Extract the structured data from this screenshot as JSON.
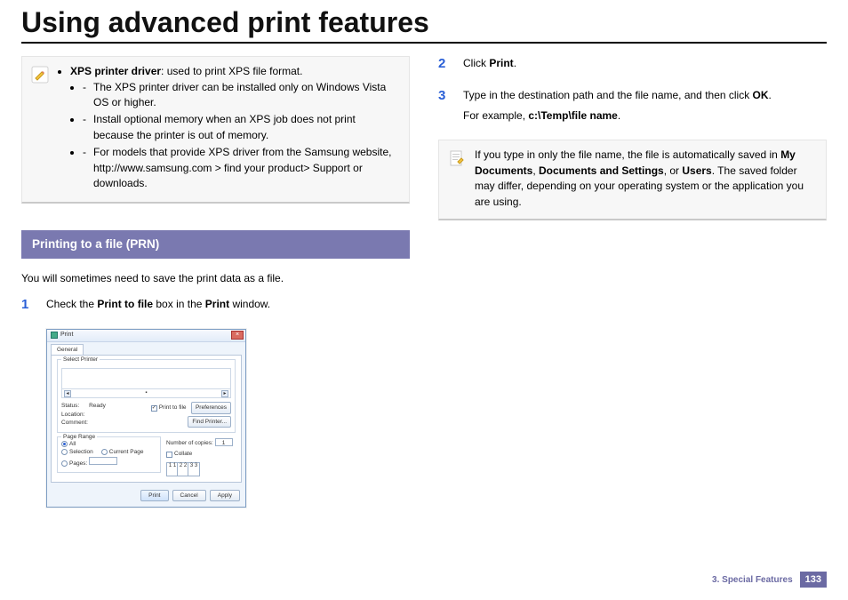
{
  "title": "Using advanced print features",
  "leftColumn": {
    "note1": {
      "bullet_lead_bold": "XPS printer driver",
      "bullet_lead_rest": ": used to print XPS file format.",
      "subs": [
        "The XPS printer driver can be installed only on Windows Vista OS or higher.",
        "Install optional memory when an XPS job does not print because the printer is out of memory.",
        "For models that provide XPS driver from the Samsung website, http://www.samsung.com  > find your product> Support or downloads."
      ]
    },
    "section_bar": "Printing to a file (PRN)",
    "intro": "You will sometimes need to save the print data as a file.",
    "step1": {
      "num": "1",
      "pre": "Check the ",
      "b1": "Print to file",
      "mid": " box in the ",
      "b2": "Print",
      "post": " window."
    },
    "dialog": {
      "title": "Print",
      "tab": "General",
      "group_select": "Select Printer",
      "status_label": "Status:",
      "status_value": "Ready",
      "location_label": "Location:",
      "comment_label": "Comment:",
      "print_to_file": "Print to file",
      "preferences": "Preferences",
      "find_printer": "Find Printer...",
      "group_range": "Page Range",
      "opt_all": "All",
      "opt_selection": "Selection",
      "opt_current": "Current Page",
      "opt_pages": "Pages:",
      "copies_label": "Number of copies:",
      "copies_value": "1",
      "collate": "Collate",
      "sheet1": "1 1",
      "sheet2": "2 2",
      "sheet3": "3 3",
      "btn_print": "Print",
      "btn_cancel": "Cancel",
      "btn_apply": "Apply"
    }
  },
  "rightColumn": {
    "step2": {
      "num": "2",
      "pre": "Click ",
      "b1": "Print",
      "post": "."
    },
    "step3": {
      "num": "3",
      "line1_pre": "Type in the destination path and the file name, and then click ",
      "line1_b": "OK",
      "line1_post": ".",
      "line2_pre": "For example, ",
      "line2_b": "c:\\Temp\\file name",
      "line2_post": "."
    },
    "note2": {
      "pre": "If you type in only the file name, the file is automatically saved in ",
      "b1": "My Documents",
      "sep1": ", ",
      "b2": "Documents and Settings",
      "sep2": ", or ",
      "b3": "Users",
      "post": ". The saved folder may differ, depending on your operating system or the application you are using."
    }
  },
  "footer": {
    "chapter": "3.  Special Features",
    "page": "133"
  }
}
